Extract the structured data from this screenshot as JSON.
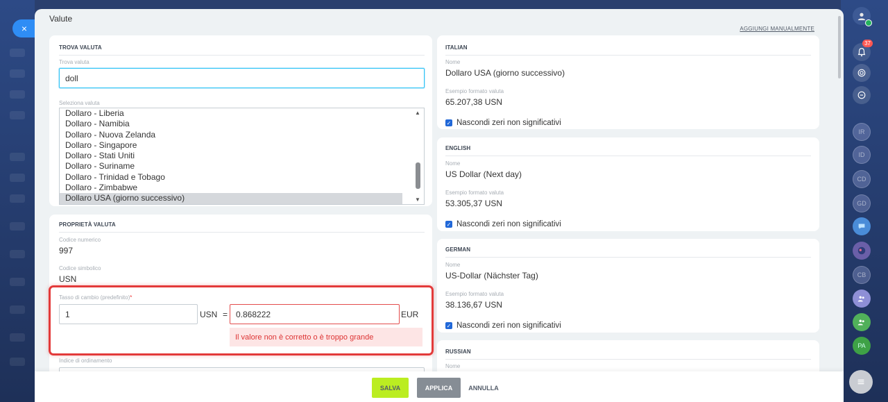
{
  "window": {
    "title": "Valute",
    "add_manually": "AGGIUNGI MANUALMENTE",
    "close": "×"
  },
  "find": {
    "header": "TROVA VALUTA",
    "search_label": "Trova valuta",
    "search_value": "doll",
    "select_label": "Seleziona valuta",
    "options": [
      "Dollaro - Liberia",
      "Dollaro - Namibia",
      "Dollaro - Nuova Zelanda",
      "Dollaro - Singapore",
      "Dollaro - Stati Uniti",
      "Dollaro - Suriname",
      "Dollaro - Trinidad e Tobago",
      "Dollaro - Zimbabwe",
      "Dollaro USA (giorno successivo)"
    ],
    "selected_index": 8
  },
  "props": {
    "header": "PROPRIETÀ VALUTA",
    "numeric_code_label": "Codice numerico",
    "numeric_code": "997",
    "symbolic_code_label": "Codice simbolico",
    "symbolic_code": "USN",
    "rate_label": "Tasso di cambio (predefinito)",
    "required_mark": "*",
    "rate_amount": "1",
    "rate_currency": "USN",
    "equals": "=",
    "rate_value": "0.868222",
    "base_currency": "EUR",
    "error_message": "Il valore non è corretto o è troppo grande",
    "sort_label": "Indice di ordinamento"
  },
  "languages": [
    {
      "header": "ITALIAN",
      "name_label": "Nome",
      "name": "Dollaro USA (giorno successivo)",
      "format_label": "Esempio formato valuta",
      "format": "65.207,38 USN",
      "checkbox": "Nascondi zeri non significativi"
    },
    {
      "header": "ENGLISH",
      "name_label": "Nome",
      "name": "US Dollar (Next day)",
      "format_label": "Esempio formato valuta",
      "format": "53.305,37 USN",
      "checkbox": "Nascondi zeri non significativi"
    },
    {
      "header": "GERMAN",
      "name_label": "Nome",
      "name": "US-Dollar (Nächster Tag)",
      "format_label": "Esempio formato valuta",
      "format": "38.136,67 USN",
      "checkbox": "Nascondi zeri non significativi"
    },
    {
      "header": "RUSSIAN",
      "name_label": "Nome"
    }
  ],
  "footer": {
    "save": "SALVA",
    "apply": "APPLICA",
    "cancel": "ANNULLA"
  },
  "right_bar": {
    "notifications_count": "37",
    "avatars": [
      "IR",
      "ID",
      "CD",
      "GD",
      "CB",
      "PA"
    ]
  },
  "colors": {
    "accent": "#2fc6f6",
    "save": "#bbed21",
    "error": "#e33a3a",
    "checkbox": "#2168d8"
  }
}
